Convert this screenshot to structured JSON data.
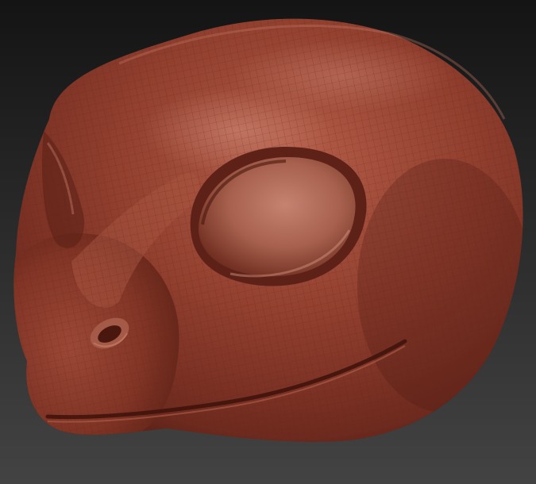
{
  "scene": {
    "subject": "clay-sculpt-reptile-head",
    "colors": {
      "background_top": "#141414",
      "background_bottom": "#434343",
      "clay_base": "#8a3a2c",
      "clay_highlight": "#c0705c",
      "clay_shadow": "#4a1a12",
      "wire_mesh": "#5c2418"
    }
  }
}
